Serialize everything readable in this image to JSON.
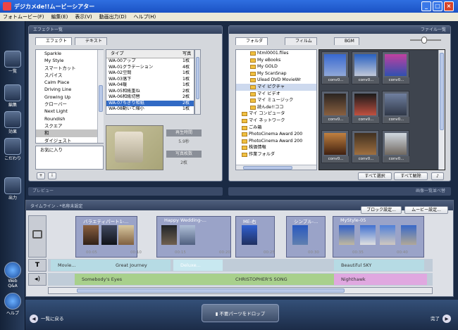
{
  "window": {
    "title": "デジカメde!!ムービーシアター"
  },
  "menu": [
    "フォトムービー(F)",
    "編集(E)",
    "表示(V)",
    "動画出力(D)",
    "ヘルプ(H)"
  ],
  "left_nav": [
    "一覧",
    "編集",
    "効果",
    "こだわり",
    "出力",
    "Web Q&A",
    "ヘルプ"
  ],
  "effect_panel": {
    "title": "エフェクト一覧",
    "tabs": [
      "エフェクト",
      "テキスト"
    ],
    "categories": [
      "Sparkle",
      "My Style",
      "スマートカット",
      "スパイス",
      "Calm Place",
      "Driving Line",
      "Growing Up",
      "クローバー",
      "Next Light",
      "Roundish",
      "スクエア",
      "和",
      "ダイジェスト"
    ],
    "selected_category": "和",
    "favorites_label": "お気に入り",
    "col_type": "タイプ",
    "col_photos": "写真",
    "types": [
      {
        "name": "WA-00アップ",
        "count": "1枚"
      },
      {
        "name": "WA-01グラデーション",
        "count": "4枚"
      },
      {
        "name": "WA-02空間",
        "count": "1枚"
      },
      {
        "name": "WA-03落下",
        "count": "1枚"
      },
      {
        "name": "WA-04暖",
        "count": "1枚"
      },
      {
        "name": "WA-05和紙重ね",
        "count": "2枚"
      },
      {
        "name": "WA-06和紙切替",
        "count": "2枚"
      },
      {
        "name": "WA-07ちぎり和紙",
        "count": "2枚"
      },
      {
        "name": "WA-08動いて縮小",
        "count": "1枚"
      }
    ],
    "selected_type": "WA-07ちぎり和紙",
    "play_time_label": "再生時間",
    "play_time_value": "5.9秒",
    "photo_count_label": "写真枚数",
    "photo_count_value": "2枚"
  },
  "file_panel": {
    "title": "ファイル一覧",
    "tabs": [
      "フォルダ",
      "フィルム",
      "BGM"
    ],
    "tree": [
      {
        "label": "html0001.files",
        "indent": 2
      },
      {
        "label": "My eBooks",
        "indent": 2
      },
      {
        "label": "My GOLD",
        "indent": 2
      },
      {
        "label": "My ScanSnap",
        "indent": 2
      },
      {
        "label": "Ulead DVD MovieWr",
        "indent": 2
      },
      {
        "label": "マイ ピクチャ",
        "indent": 2
      },
      {
        "label": "マイ ビデオ",
        "indent": 2
      },
      {
        "label": "マイ ミュージック",
        "indent": 2
      },
      {
        "label": "読んde!!ココ",
        "indent": 2
      },
      {
        "label": "マイ コンピュータ",
        "indent": 0
      },
      {
        "label": "マイ ネットワーク",
        "indent": 0
      },
      {
        "label": "ごみ箱",
        "indent": 0
      },
      {
        "label": "PhotoCinema Award 200",
        "indent": 0
      },
      {
        "label": "PhotoCinema Award 200",
        "indent": 0
      },
      {
        "label": "株価情報",
        "indent": 0
      },
      {
        "label": "作業フォルダ",
        "indent": 0
      }
    ],
    "selected_folder": "マイ ピクチャ",
    "thumb_caption": "conv0...",
    "select_all": "すべて選択",
    "deselect_all": "すべて解除"
  },
  "preview": {
    "label": "プレビュー",
    "sort_label": "画像一覧並べ替"
  },
  "timeline": {
    "title": "タイムライン - *名称未設定",
    "block_settings": "ブロック設定...",
    "movie_settings": "ムービー設定...",
    "clips": [
      "バラエティパート1-...",
      "Happy Wedding-...",
      "ME-右",
      "シンプル-...",
      "MyStyle-05"
    ],
    "time_marks": [
      "00:05",
      "00:10",
      "00:15",
      "00:20",
      "00:25",
      "00:30",
      "00:35",
      "00:40"
    ],
    "text_items": [
      "Movie...",
      "Great Journey",
      "Deluxe...",
      "Beautiful SKY"
    ],
    "audio_items": [
      "Somebody's Eyes",
      "CHRISTOPHER'S SONG",
      "Nighthawk"
    ]
  },
  "footer": {
    "back": "一覧に戻る",
    "drop": "不要パーツをドロップ",
    "done": "完了"
  }
}
